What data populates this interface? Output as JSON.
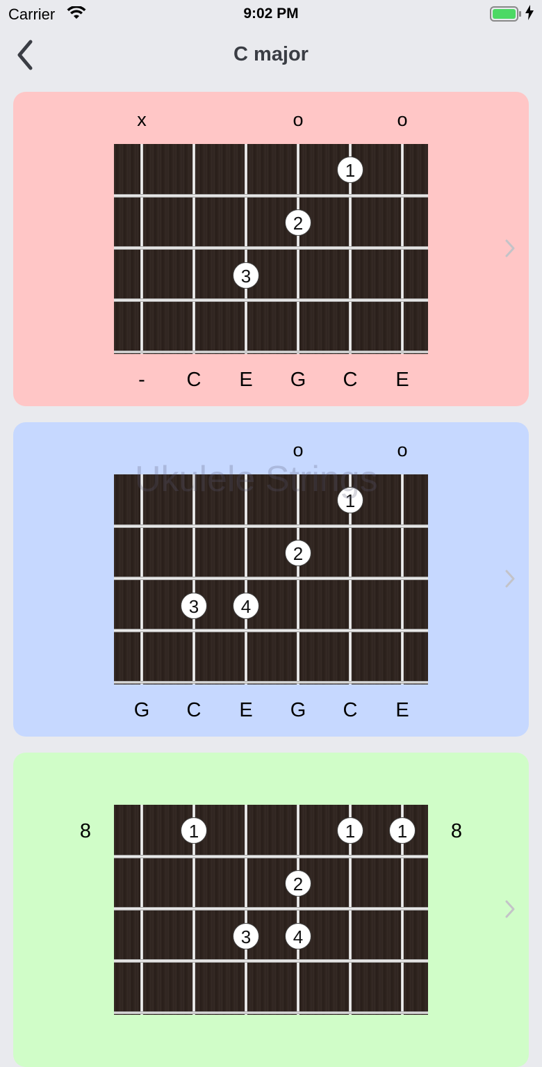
{
  "status_bar": {
    "carrier": "Carrier",
    "time": "9:02 PM",
    "battery_color": "#4cd964"
  },
  "nav": {
    "title": "C major",
    "back_icon": "chevron-left-icon"
  },
  "cards": [
    {
      "background": "#ffc6c6",
      "open_markers": [
        "x",
        "",
        "",
        "o",
        "",
        "o"
      ],
      "fingers": [
        {
          "string": 5,
          "fret": 1,
          "label": "1"
        },
        {
          "string": 4,
          "fret": 2,
          "label": "2"
        },
        {
          "string": 3,
          "fret": 3,
          "label": "3"
        }
      ],
      "notes": [
        "-",
        "C",
        "E",
        "G",
        "C",
        "E"
      ],
      "fret_label": ""
    },
    {
      "background": "#c6d8ff",
      "open_markers": [
        "",
        "",
        "",
        "o",
        "",
        "o"
      ],
      "watermark": "Ukulele Strings",
      "fingers": [
        {
          "string": 5,
          "fret": 1,
          "label": "1"
        },
        {
          "string": 4,
          "fret": 2,
          "label": "2"
        },
        {
          "string": 2,
          "fret": 3,
          "label": "3"
        },
        {
          "string": 3,
          "fret": 3,
          "label": "4"
        }
      ],
      "notes": [
        "G",
        "C",
        "E",
        "G",
        "C",
        "E"
      ],
      "fret_label": ""
    },
    {
      "background": "#d0fdc8",
      "open_markers": [
        "",
        "",
        "",
        "",
        "",
        ""
      ],
      "fingers": [
        {
          "string": 2,
          "fret": 1,
          "label": "1"
        },
        {
          "string": 5,
          "fret": 1,
          "label": "1"
        },
        {
          "string": 6,
          "fret": 1,
          "label": "1"
        },
        {
          "string": 4,
          "fret": 2,
          "label": "2"
        },
        {
          "string": 3,
          "fret": 3,
          "label": "3"
        },
        {
          "string": 4,
          "fret": 3,
          "label": "4"
        }
      ],
      "notes": [],
      "fret_label": "8"
    }
  ]
}
